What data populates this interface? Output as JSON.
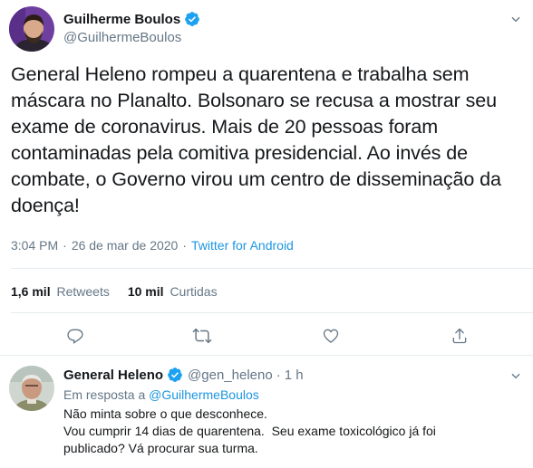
{
  "tweet": {
    "author_name": "Guilherme Boulos",
    "author_handle": "@GuilhermeBoulos",
    "text": "General Heleno rompeu a quarentena e trabalha sem máscara no Planalto. Bolsonaro se recusa a mostrar seu exame de coronavirus. Mais de 20 pessoas foram contaminadas pela comitiva presidencial. Ao invés de combate, o Governo virou um centro de disseminação da doença!",
    "time": "3:04 PM",
    "date": "26 de mar de 2020",
    "separator": "·",
    "source": "Twitter for Android",
    "retweets_count": "1,6 mil",
    "retweets_label": "Retweets",
    "likes_count": "10 mil",
    "likes_label": "Curtidas",
    "icons": {
      "verified": "verified-badge-icon",
      "caret": "chevron-down-icon",
      "reply": "reply-icon",
      "retweet": "retweet-icon",
      "like": "heart-icon",
      "share": "share-icon"
    }
  },
  "reply": {
    "author_name": "General Heleno",
    "author_handle": "@gen_heleno",
    "separator": "·",
    "time_ago": "1 h",
    "in_reply_prefix": "Em resposta a",
    "in_reply_handle": "@GuilhermeBoulos",
    "lines": [
      "Não minta sobre o que desconhece.",
      "Vou cumprir 14 dias de quarentena.  Seu exame toxicológico já foi",
      "publicado? Vá procurar sua turma."
    ]
  },
  "colors": {
    "text": "#14171a",
    "secondary": "#657786",
    "link": "#1b95e0",
    "verified": "#1da1f2",
    "divider": "#e6ecf0",
    "icon": "#657786"
  }
}
